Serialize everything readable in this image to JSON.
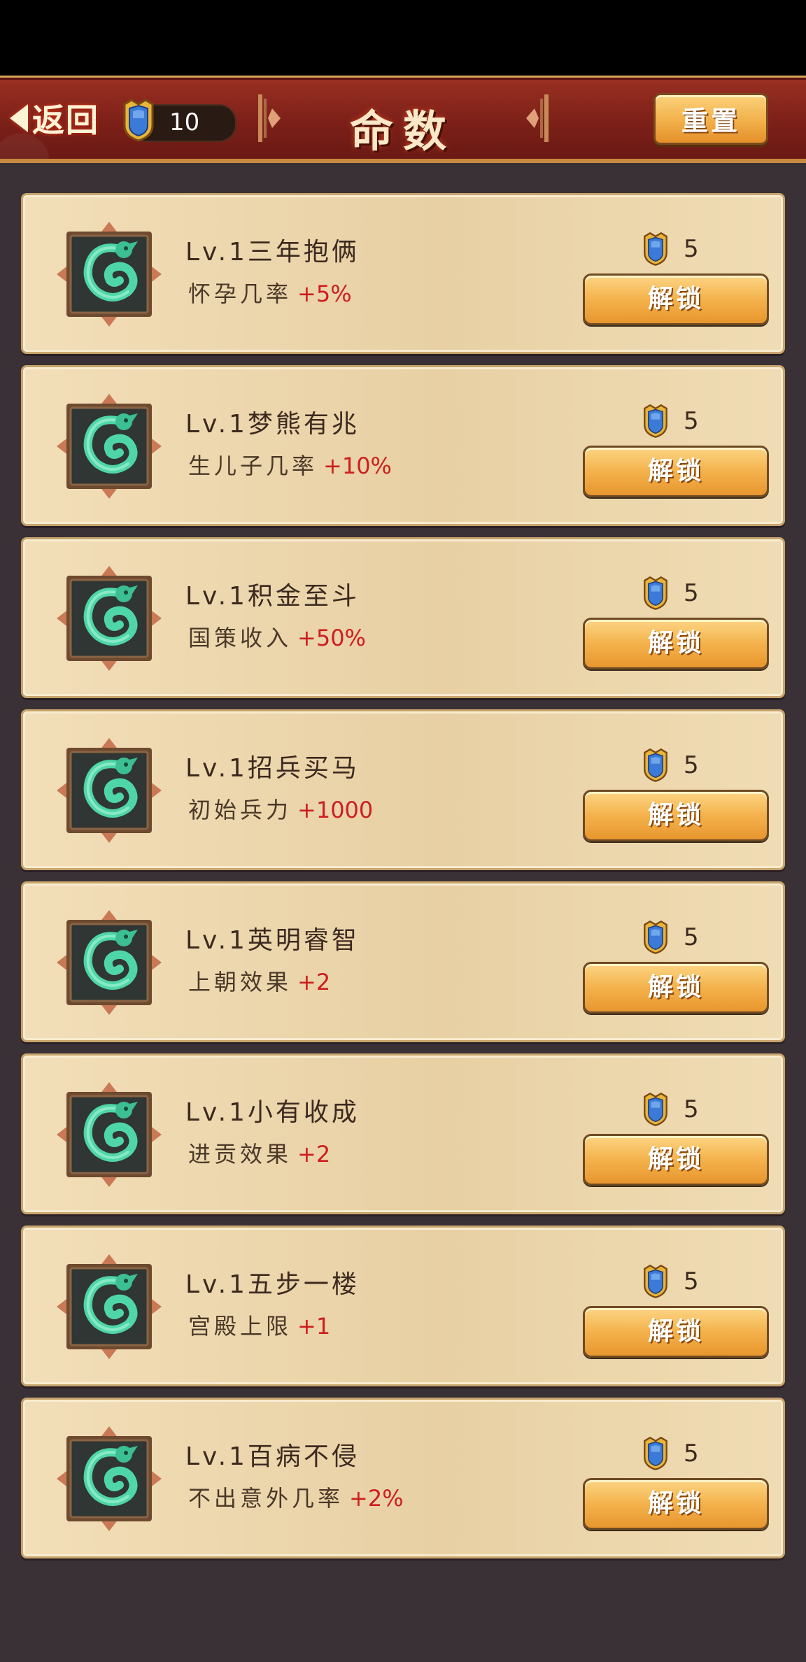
{
  "header": {
    "back_label": "返回",
    "token_count": "10",
    "title": "命数",
    "reset_label": "重置"
  },
  "colors": {
    "header_red": "#8a271d",
    "card_bg": "#ecd6ac",
    "button_orange": "#f2b04a",
    "bonus_red": "#cc1f1f",
    "page_bg": "#3a3136"
  },
  "cards": [
    {
      "name": "Lv.1三年抱俩",
      "effect": "怀孕几率",
      "bonus": "+5%",
      "cost": "5",
      "button": "解锁"
    },
    {
      "name": "Lv.1梦熊有兆",
      "effect": "生儿子几率",
      "bonus": "+10%",
      "cost": "5",
      "button": "解锁"
    },
    {
      "name": "Lv.1积金至斗",
      "effect": "国策收入",
      "bonus": "+50%",
      "cost": "5",
      "button": "解锁"
    },
    {
      "name": "Lv.1招兵买马",
      "effect": "初始兵力",
      "bonus": "+1000",
      "cost": "5",
      "button": "解锁"
    },
    {
      "name": "Lv.1英明睿智",
      "effect": "上朝效果",
      "bonus": "+2",
      "cost": "5",
      "button": "解锁"
    },
    {
      "name": "Lv.1小有收成",
      "effect": "进贡效果",
      "bonus": "+2",
      "cost": "5",
      "button": "解锁"
    },
    {
      "name": "Lv.1五步一楼",
      "effect": "宫殿上限",
      "bonus": "+1",
      "cost": "5",
      "button": "解锁"
    },
    {
      "name": "Lv.1百病不侵",
      "effect": "不出意外几率",
      "bonus": "+2%",
      "cost": "5",
      "button": "解锁"
    }
  ],
  "icons": {
    "token": "shield-token-icon",
    "emblem": "jade-dragon-icon",
    "back": "back-arrow-icon"
  }
}
